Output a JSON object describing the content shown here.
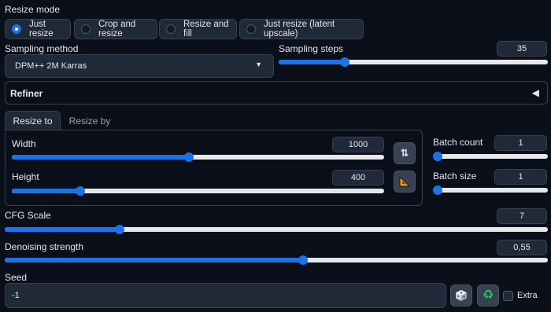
{
  "resize_mode": {
    "label": "Resize mode",
    "options": [
      "Just resize",
      "Crop and resize",
      "Resize and fill",
      "Just resize (latent upscale)"
    ],
    "selected": "Just resize"
  },
  "sampling_method": {
    "label": "Sampling method",
    "value": "DPM++ 2M Karras"
  },
  "sampling_steps": {
    "label": "Sampling steps",
    "value": "35",
    "fraction": 0.236
  },
  "refiner": {
    "label": "Refiner"
  },
  "tabs": [
    "Resize to",
    "Resize by"
  ],
  "width": {
    "label": "Width",
    "value": "1000",
    "fraction": 0.476
  },
  "height": {
    "label": "Height",
    "value": "400",
    "fraction": 0.175
  },
  "batch_count": {
    "label": "Batch count",
    "value": "1",
    "fraction": 0.0
  },
  "batch_size": {
    "label": "Batch size",
    "value": "1",
    "fraction": 0.0
  },
  "cfg_scale": {
    "label": "CFG Scale",
    "value": "7",
    "fraction": 0.207
  },
  "denoising": {
    "label": "Denoising strength",
    "value": "0,55",
    "fraction": 0.55
  },
  "seed": {
    "label": "Seed",
    "value": "-1",
    "extra_label": "Extra"
  },
  "colors": {
    "accent": "#1a73e8",
    "background": "#0b0f19",
    "surface": "#1f2937"
  }
}
